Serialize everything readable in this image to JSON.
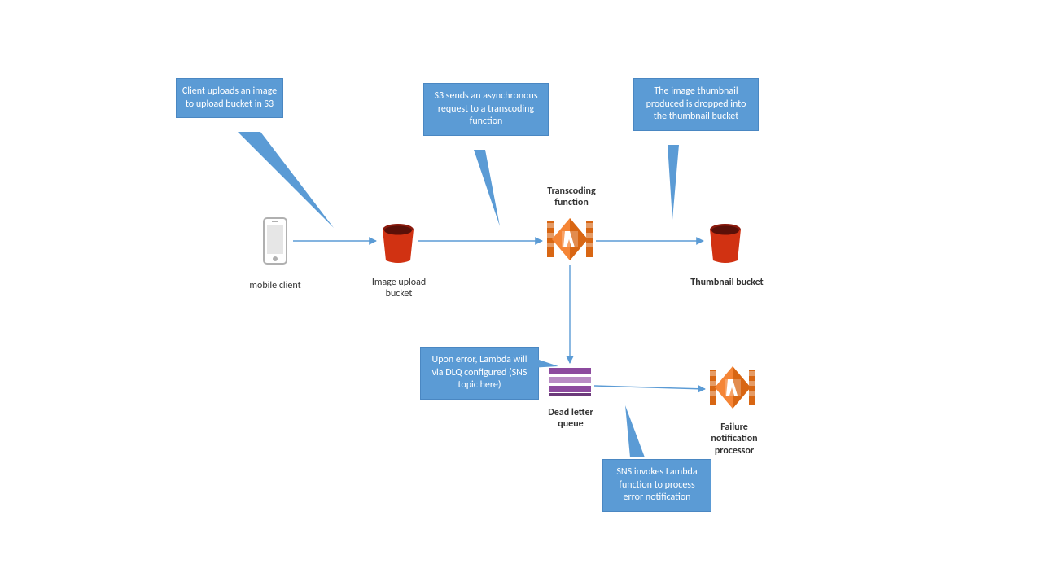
{
  "nodes": {
    "mobile": {
      "label": "mobile client"
    },
    "upload": {
      "label": "Image upload bucket"
    },
    "transcode": {
      "label": "Transcoding function"
    },
    "thumb": {
      "label": "Thumbnail bucket"
    },
    "dlq": {
      "label": "Dead letter queue"
    },
    "fail": {
      "label": "Failure notification processor"
    }
  },
  "callouts": {
    "c1": "Client uploads an image to upload bucket in S3",
    "c2": "S3 sends an asynchronous request to a transcoding function",
    "c3": "The image thumbnail produced is dropped into the thumbnail bucket",
    "c4": "Upon error, Lambda will via DLQ configured (SNS topic here)",
    "c5": "SNS invokes Lambda function to process error notification"
  },
  "colors": {
    "callout_fill": "#5B9BD5",
    "arrow": "#5B9BD5",
    "bucket": "#D13212",
    "lambda": "#D86613",
    "queue1": "#8C4A9E",
    "queue2": "#B88BC4",
    "phone": "#B0B0B0"
  }
}
